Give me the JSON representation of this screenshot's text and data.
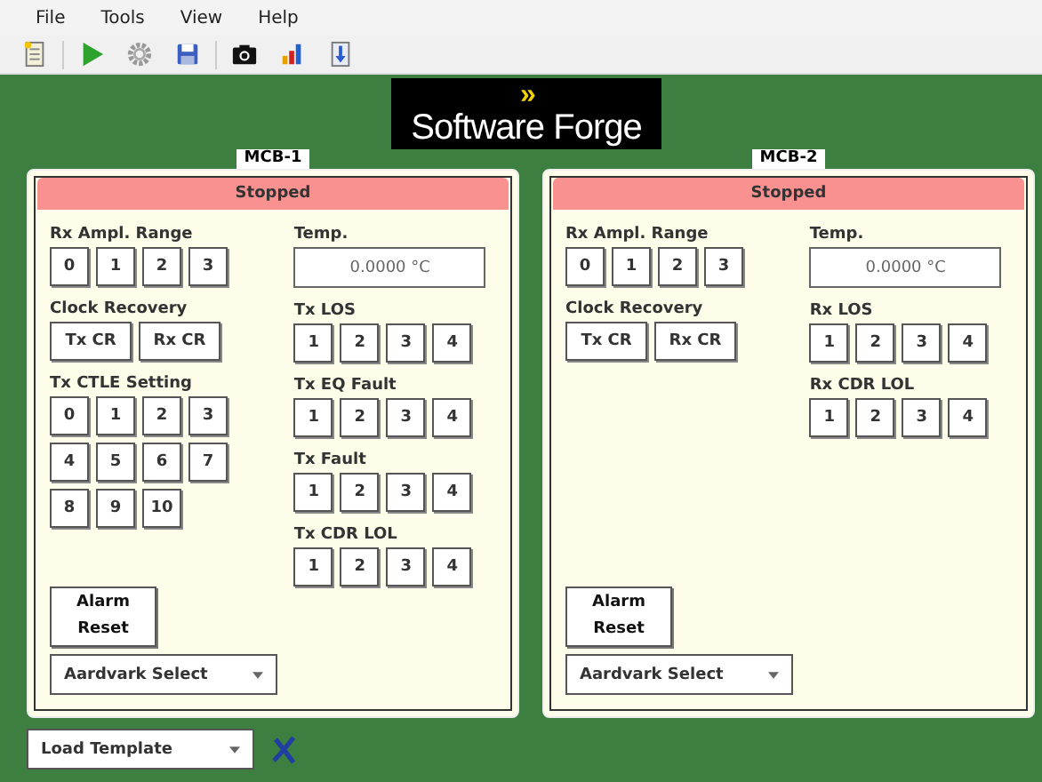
{
  "menu": [
    "File",
    "Tools",
    "View",
    "Help"
  ],
  "toolbar": [
    {
      "kind": "document"
    },
    {
      "kind": "play"
    },
    {
      "kind": "gear"
    },
    {
      "kind": "save"
    },
    {
      "kind": "camera"
    },
    {
      "kind": "chart"
    },
    {
      "kind": "download"
    }
  ],
  "logo": {
    "mark": "»",
    "text": "Software Forge"
  },
  "panels": [
    {
      "title": "MCB-1",
      "status": "Stopped",
      "left": [
        {
          "kind": "buttons",
          "label": "Rx Ampl. Range",
          "items": [
            "0",
            "1",
            "2",
            "3"
          ]
        },
        {
          "kind": "buttons",
          "label": "Clock Recovery",
          "items": [
            "Tx CR",
            "Rx CR"
          ]
        },
        {
          "kind": "buttons",
          "label": "Tx CTLE Setting",
          "items": [
            "0",
            "1",
            "2",
            "3",
            "4",
            "5",
            "6",
            "7",
            "8",
            "9",
            "10"
          ]
        }
      ],
      "right": [
        {
          "kind": "field",
          "label": "Temp.",
          "value": "0.0000 °C"
        },
        {
          "kind": "buttons",
          "label": "Tx LOS",
          "items": [
            "1",
            "2",
            "3",
            "4"
          ]
        },
        {
          "kind": "buttons",
          "label": "Tx EQ Fault",
          "items": [
            "1",
            "2",
            "3",
            "4"
          ]
        },
        {
          "kind": "buttons",
          "label": "Tx Fault",
          "items": [
            "1",
            "2",
            "3",
            "4"
          ]
        },
        {
          "kind": "buttons",
          "label": "Tx CDR LOL",
          "items": [
            "1",
            "2",
            "3",
            "4"
          ]
        }
      ],
      "alarm_button": "Alarm Reset",
      "select": "Aardvark Select"
    },
    {
      "title": "MCB-2",
      "status": "Stopped",
      "left": [
        {
          "kind": "buttons",
          "label": "Rx Ampl. Range",
          "items": [
            "0",
            "1",
            "2",
            "3"
          ]
        },
        {
          "kind": "buttons",
          "label": "Clock Recovery",
          "items": [
            "Tx CR",
            "Rx CR"
          ]
        }
      ],
      "right": [
        {
          "kind": "field",
          "label": "Temp.",
          "value": "0.0000 °C"
        },
        {
          "kind": "buttons",
          "label": "Rx LOS",
          "items": [
            "1",
            "2",
            "3",
            "4"
          ]
        },
        {
          "kind": "buttons",
          "label": "Rx CDR LOL",
          "items": [
            "1",
            "2",
            "3",
            "4"
          ]
        }
      ],
      "alarm_button": "Alarm Reset",
      "select": "Aardvark Select"
    }
  ],
  "template_select": "Load Template"
}
